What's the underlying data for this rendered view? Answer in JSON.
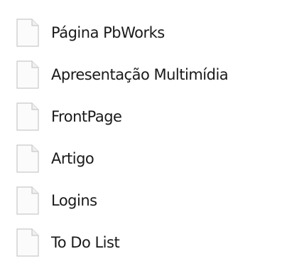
{
  "pages": [
    {
      "label": "Página PbWorks",
      "icon": "document-icon"
    },
    {
      "label": "Apresentação Multimídia",
      "icon": "document-icon"
    },
    {
      "label": "FrontPage",
      "icon": "document-icon"
    },
    {
      "label": "Artigo",
      "icon": "document-icon"
    },
    {
      "label": "Logins",
      "icon": "document-icon"
    },
    {
      "label": "To Do List",
      "icon": "document-icon"
    }
  ],
  "colors": {
    "text": "#1a1a1a",
    "icon_border": "#c9c9c9",
    "icon_fill": "#fbfbfb"
  }
}
